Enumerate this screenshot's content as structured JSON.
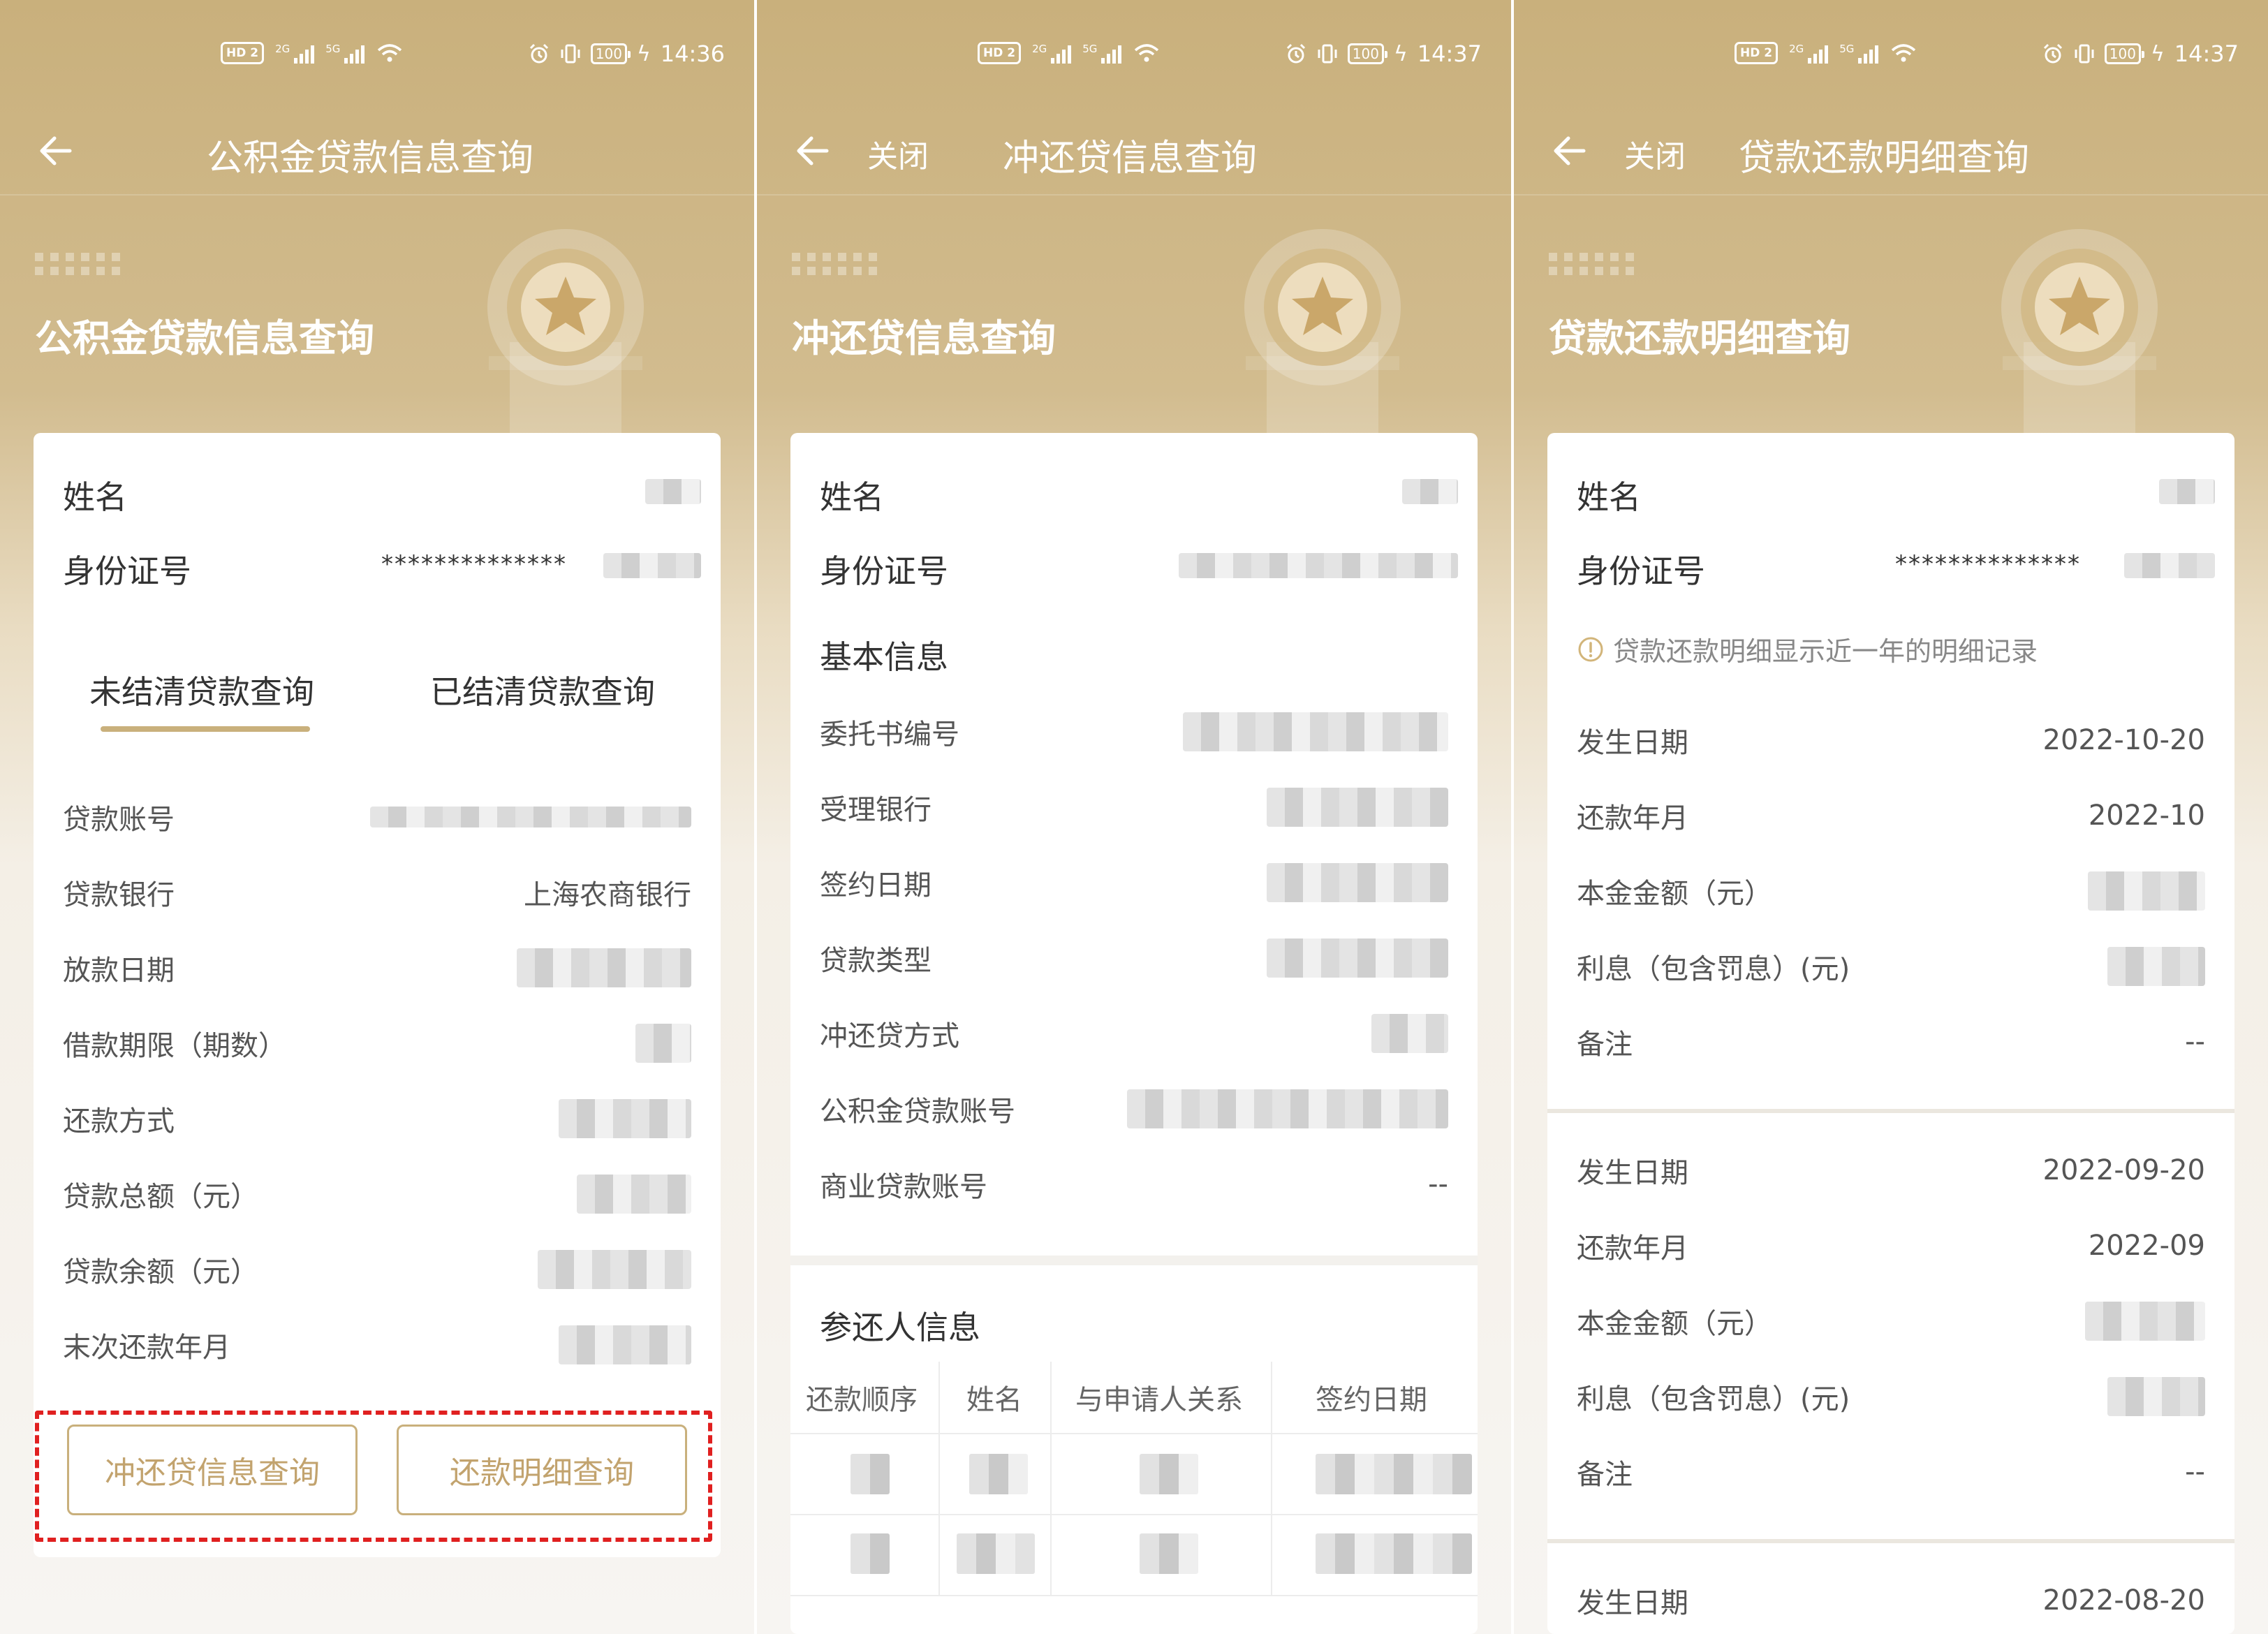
{
  "status_bars": [
    {
      "hd": "HD 2",
      "net1": "2G",
      "net2": "5G",
      "battery": "100",
      "time": "14:36"
    },
    {
      "hd": "HD 2",
      "net1": "2G",
      "net2": "5G",
      "battery": "100",
      "time": "14:37"
    },
    {
      "hd": "HD 2",
      "net1": "2G",
      "net2": "5G",
      "battery": "100",
      "time": "14:37"
    }
  ],
  "colors": {
    "brand_gold": "#c9b07c",
    "highlight_red": "#e02020",
    "white": "#ffffff"
  },
  "screen1": {
    "nav_title": "公积金贷款信息查询",
    "banner_title": "公积金贷款信息查询",
    "name_label": "姓名",
    "id_label": "身份证号",
    "id_value_masked": "**************",
    "tabs": [
      {
        "label": "未结清贷款查询",
        "active": true
      },
      {
        "label": "已结清贷款查询",
        "active": false
      }
    ],
    "rows": [
      {
        "label": "贷款账号"
      },
      {
        "label": "贷款银行",
        "value": "上海农商银行"
      },
      {
        "label": "放款日期"
      },
      {
        "label": "借款期限（期数）"
      },
      {
        "label": "还款方式"
      },
      {
        "label": "贷款总额（元）"
      },
      {
        "label": "贷款余额（元）"
      },
      {
        "label": "末次还款年月"
      }
    ],
    "buttons": {
      "repay_info": "冲还贷信息查询",
      "repay_detail": "还款明细查询"
    }
  },
  "screen2": {
    "close_label": "关闭",
    "nav_title": "冲还贷信息查询",
    "banner_title": "冲还贷信息查询",
    "name_label": "姓名",
    "id_label": "身份证号",
    "basic_section": "基本信息",
    "rows": [
      {
        "label": "委托书编号"
      },
      {
        "label": "受理银行"
      },
      {
        "label": "签约日期"
      },
      {
        "label": "贷款类型"
      },
      {
        "label": "冲还贷方式"
      },
      {
        "label": "公积金贷款账号"
      },
      {
        "label": "商业贷款账号",
        "value": "--"
      }
    ],
    "co_section": "参还人信息",
    "table_headers": [
      "还款顺序",
      "姓名",
      "与申请人关系",
      "签约日期"
    ]
  },
  "screen3": {
    "close_label": "关闭",
    "nav_title": "贷款还款明细查询",
    "banner_title": "贷款还款明细查询",
    "name_label": "姓名",
    "id_label": "身份证号",
    "id_value_masked": "**************",
    "notice": "贷款还款明细显示近一年的明细记录",
    "labels": {
      "date": "发生日期",
      "month": "还款年月",
      "principal": "本金金额（元）",
      "interest": "利息（包含罚息）(元)",
      "remark": "备注"
    },
    "records": [
      {
        "date": "2022-10-20",
        "month": "2022-10",
        "remark": "--"
      },
      {
        "date": "2022-09-20",
        "month": "2022-09",
        "remark": "--"
      },
      {
        "date": "2022-08-20"
      }
    ]
  }
}
